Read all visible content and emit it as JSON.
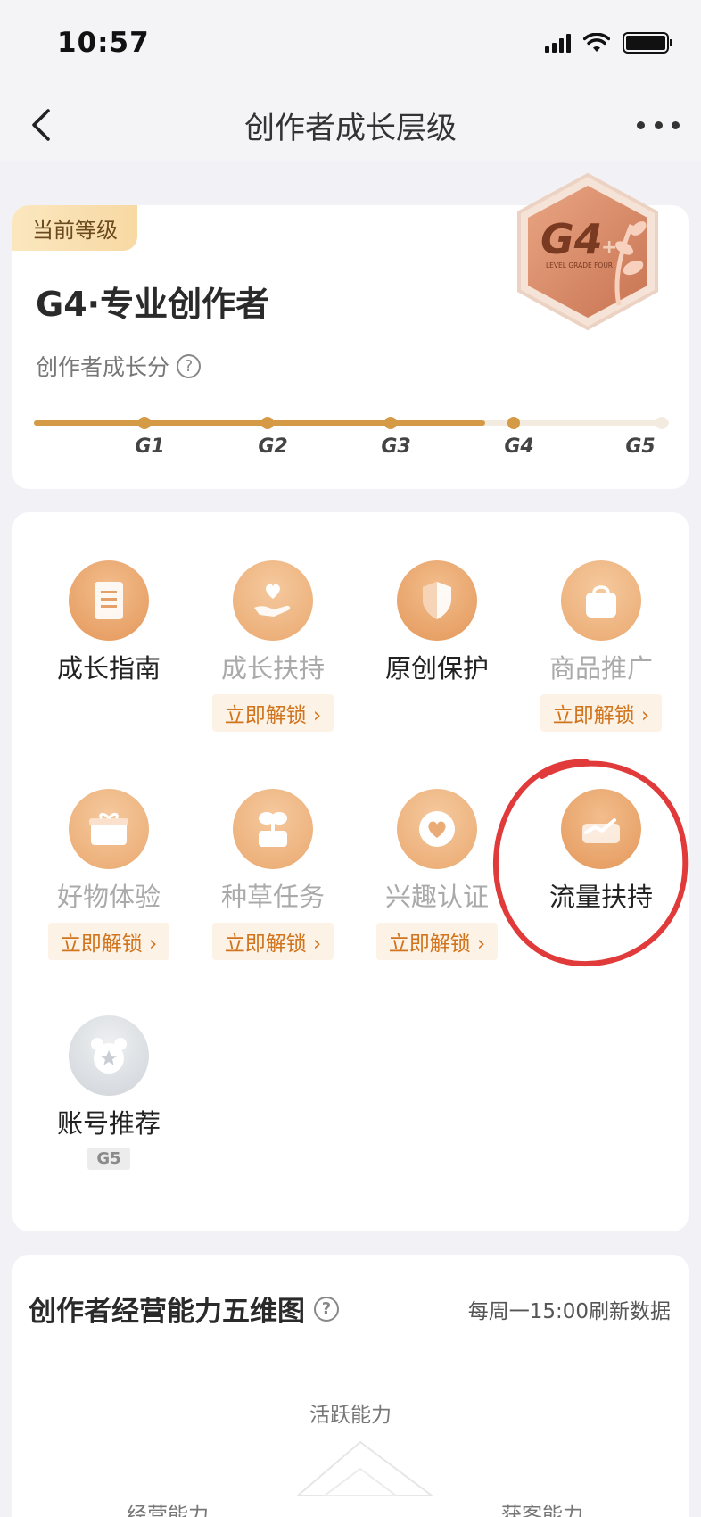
{
  "status_bar": {
    "time": "10:57"
  },
  "nav": {
    "title": "创作者成长层级"
  },
  "level_card": {
    "tag": "当前等级",
    "level_name": "G4·专业创作者",
    "score_label": "创作者成长分",
    "help_glyph": "?",
    "grades": [
      "G1",
      "G2",
      "G3",
      "G4",
      "G5"
    ],
    "current_grade_index": 3,
    "progress_fraction": 0.71,
    "badge": {
      "main": "G4",
      "plus": "+",
      "subtitle": "LEVEL GRADE FOUR"
    }
  },
  "features": [
    {
      "label": "成长指南",
      "locked": false,
      "action": "",
      "icon": "document-icon"
    },
    {
      "label": "成长扶持",
      "locked": true,
      "action": "立即解锁 ›",
      "icon": "heart-hand-icon"
    },
    {
      "label": "原创保护",
      "locked": false,
      "action": "",
      "icon": "shield-icon"
    },
    {
      "label": "商品推广",
      "locked": true,
      "action": "立即解锁 ›",
      "icon": "shopping-bag-icon"
    },
    {
      "label": "好物体验",
      "locked": true,
      "action": "立即解锁 ›",
      "icon": "gift-box-icon"
    },
    {
      "label": "种草任务",
      "locked": true,
      "action": "立即解锁 ›",
      "icon": "plant-pot-icon"
    },
    {
      "label": "兴趣认证",
      "locked": true,
      "action": "立即解锁 ›",
      "icon": "heart-badge-icon"
    },
    {
      "label": "流量扶持",
      "locked": false,
      "action": "",
      "icon": "traffic-chart-icon"
    },
    {
      "label": "账号推荐",
      "locked": true,
      "action": "",
      "grade_required": "G5",
      "icon": "star-bear-icon"
    }
  ],
  "radar": {
    "title": "创作者经营能力五维图",
    "refresh_note": "每周一15:00刷新数据",
    "axes": [
      "活跃能力",
      "经营能力",
      "获客能力"
    ]
  },
  "colors": {
    "accent": "#d49a45",
    "unlock_text": "#d0741e",
    "highlight": "#e03a3a"
  }
}
